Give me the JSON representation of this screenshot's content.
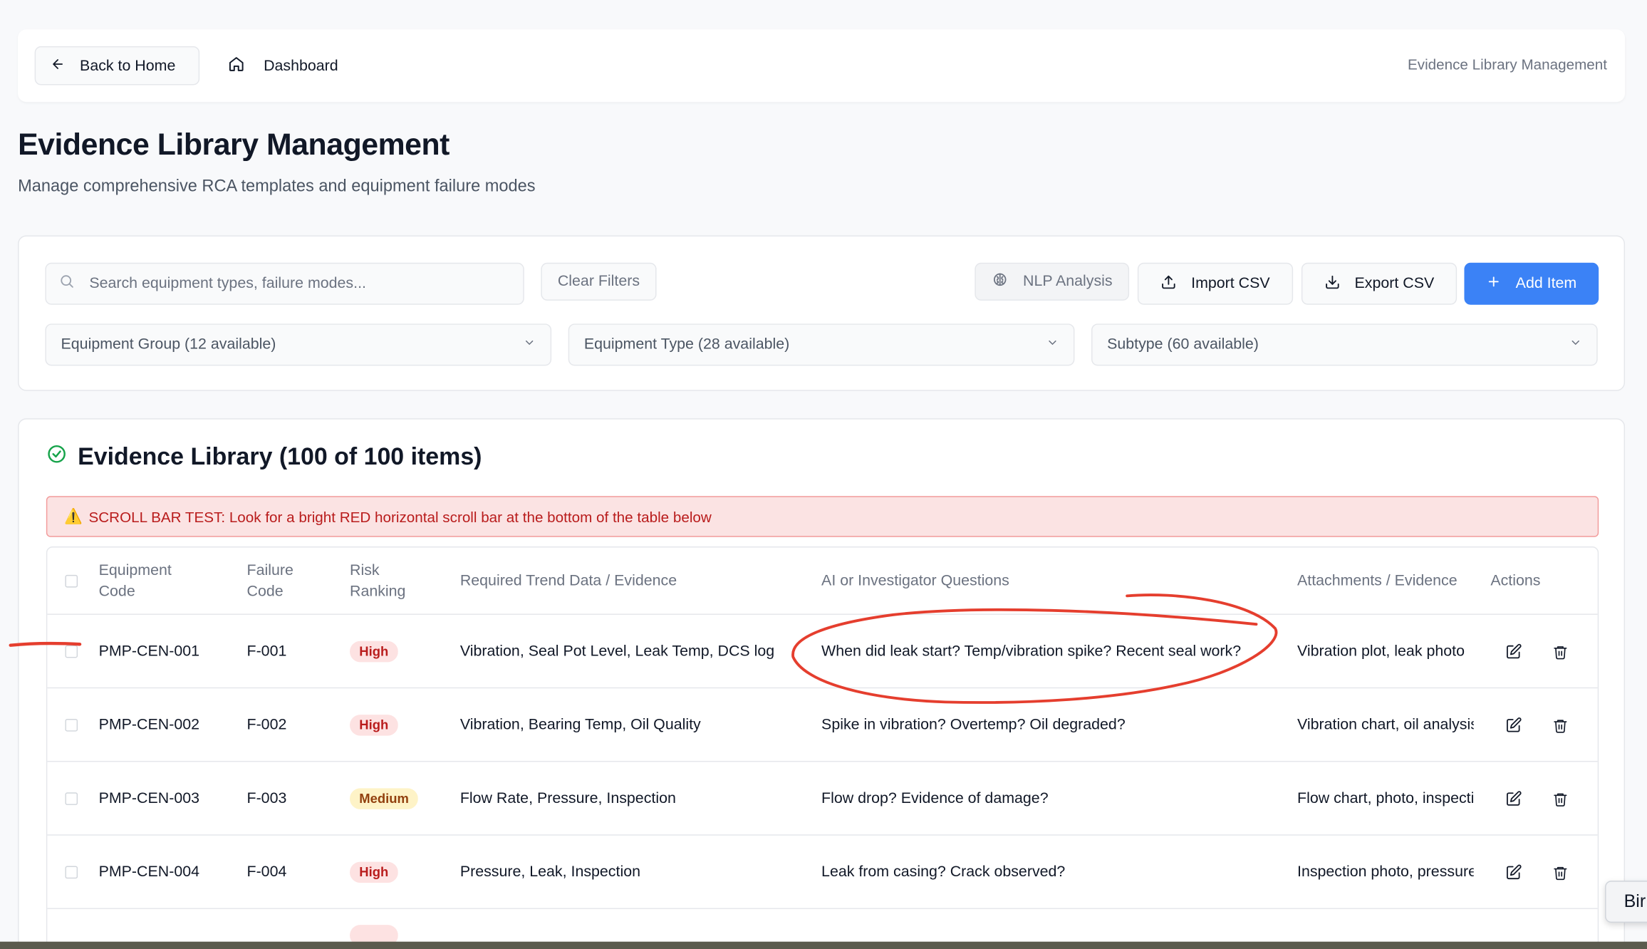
{
  "nav": {
    "back_label": "Back to Home",
    "dashboard_label": "Dashboard",
    "breadcrumb": "Evidence Library Management"
  },
  "page": {
    "title": "Evidence Library Management",
    "subtitle": "Manage comprehensive RCA templates and equipment failure modes"
  },
  "filters": {
    "search_placeholder": "Search equipment types, failure modes...",
    "clear_label": "Clear Filters",
    "nlp_label": "NLP Analysis",
    "import_label": "Import CSV",
    "export_label": "Export CSV",
    "add_label": "Add Item",
    "group_select": "Equipment Group (12 available)",
    "type_select": "Equipment Type (28 available)",
    "subtype_select": "Subtype (60 available)"
  },
  "library": {
    "title": "Evidence Library (100 of 100 items)",
    "alert_icon": "⚠️",
    "alert_text": "SCROLL BAR TEST: Look for a bright RED horizontal scroll bar at the bottom of the table below"
  },
  "table": {
    "headers": {
      "equipment_code": "Equipment\nCode",
      "failure_code": "Failure\nCode",
      "risk_ranking": "Risk\nRanking",
      "trend": "Required Trend Data / Evidence",
      "questions": "AI or Investigator Questions",
      "attachments": "Attachments / Evidence",
      "actions": "Actions"
    },
    "rows": [
      {
        "equipment_code": "PMP-CEN-001",
        "failure_code": "F-001",
        "risk": "High",
        "trend": "Vibration, Seal Pot Level, Leak Temp, DCS log",
        "questions": "When did leak start? Temp/vibration spike? Recent seal work?",
        "attachments": "Vibration plot, leak photo"
      },
      {
        "equipment_code": "PMP-CEN-002",
        "failure_code": "F-002",
        "risk": "High",
        "trend": "Vibration, Bearing Temp, Oil Quality",
        "questions": "Spike in vibration? Overtemp? Oil degraded?",
        "attachments": "Vibration chart, oil analysis"
      },
      {
        "equipment_code": "PMP-CEN-003",
        "failure_code": "F-003",
        "risk": "Medium",
        "trend": "Flow Rate, Pressure, Inspection",
        "questions": "Flow drop? Evidence of damage?",
        "attachments": "Flow chart, photo, inspection"
      },
      {
        "equipment_code": "PMP-CEN-004",
        "failure_code": "F-004",
        "risk": "High",
        "trend": "Pressure, Leak, Inspection",
        "questions": "Leak from casing? Crack observed?",
        "attachments": "Inspection photo, pressure"
      }
    ]
  },
  "tooltip_text": "Bir",
  "colors": {
    "primary": "#3b82f6",
    "high_badge": "#fde2e2",
    "medium_badge": "#fef3c7",
    "alert_bg": "#fbe3e3",
    "annotation": "#e53e2e"
  }
}
